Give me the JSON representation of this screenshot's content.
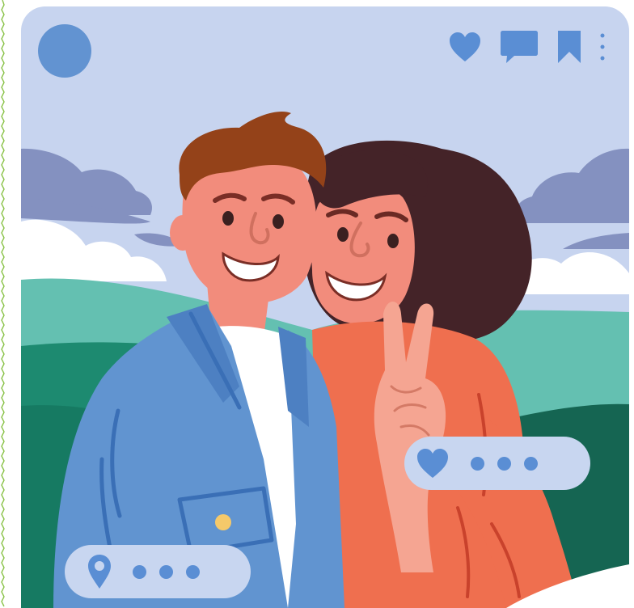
{
  "post": {
    "avatar_icon": "user-avatar-circle",
    "actions": [
      {
        "name": "like",
        "icon": "heart-icon"
      },
      {
        "name": "comment",
        "icon": "comment-icon"
      },
      {
        "name": "bookmark",
        "icon": "bookmark-icon"
      },
      {
        "name": "more",
        "icon": "vertical-ellipsis-icon"
      }
    ],
    "like_chip": {
      "icon": "heart-icon",
      "dots": 3
    },
    "location_chip": {
      "icon": "location-pin-icon",
      "dots": 3
    }
  },
  "colors": {
    "card_bg": "#c7d4ef",
    "accent_blue": "#5a8ed4",
    "chip_bg": "#c8d6f0",
    "edge_dots": "#8bc34a"
  }
}
